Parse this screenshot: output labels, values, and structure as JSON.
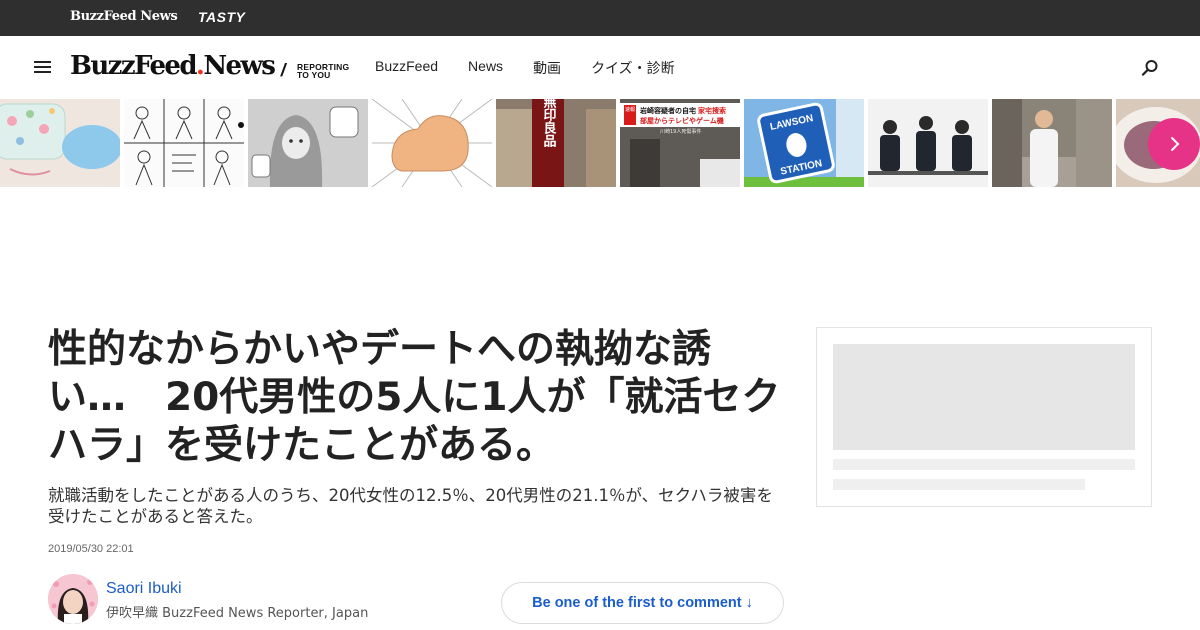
{
  "top_bar": {
    "brand_news": "BuzzFeed News",
    "brand_tasty": "TASTY"
  },
  "nav": {
    "logo_main": "BuzzFeed",
    "logo_dot": ".",
    "logo_news": "News",
    "slash": "/",
    "tagline_line1": "REPORTING",
    "tagline_line2": "TO YOU",
    "links": [
      "BuzzFeed",
      "News",
      "動画",
      "クイズ・診断"
    ]
  },
  "carousel": {
    "thumbnails": [
      "pouch-photo",
      "manga-sketch",
      "ghost-illustration",
      "flexed-arm",
      "mujirushi-store",
      "news-broadcast",
      "lawson-station",
      "job-seekers",
      "man-street",
      "food-plate"
    ],
    "store_sign": "無印良品",
    "news_caption_1": "岩崎容疑者の自宅",
    "news_caption_2": "家宅捜索",
    "news_caption_3": "部屋からテレビやゲーム機",
    "news_caption_4": "川崎19人死傷事件",
    "news_badge": "速報",
    "lawson_text_1": "LAWSON",
    "lawson_text_2": "STATION",
    "accent": "#e63387"
  },
  "article": {
    "headline": "性的なからかいやデートへの執拗な誘い…　20代男性の5人に1人が「就活セクハラ」を受けたことがある。",
    "dek": "就職活動をしたことがある人のうち、20代女性の12.5％、20代男性の21.1％が、セクハラ被害を受けたことがあると答えた。",
    "timestamp": "2019/05/30 22:01",
    "author_name": "Saori Ibuki",
    "author_title": "伊吹早織 BuzzFeed News Reporter, Japan",
    "comment_cta": "Be one of the first to comment ↓",
    "link_color": "#1a5dcc"
  }
}
